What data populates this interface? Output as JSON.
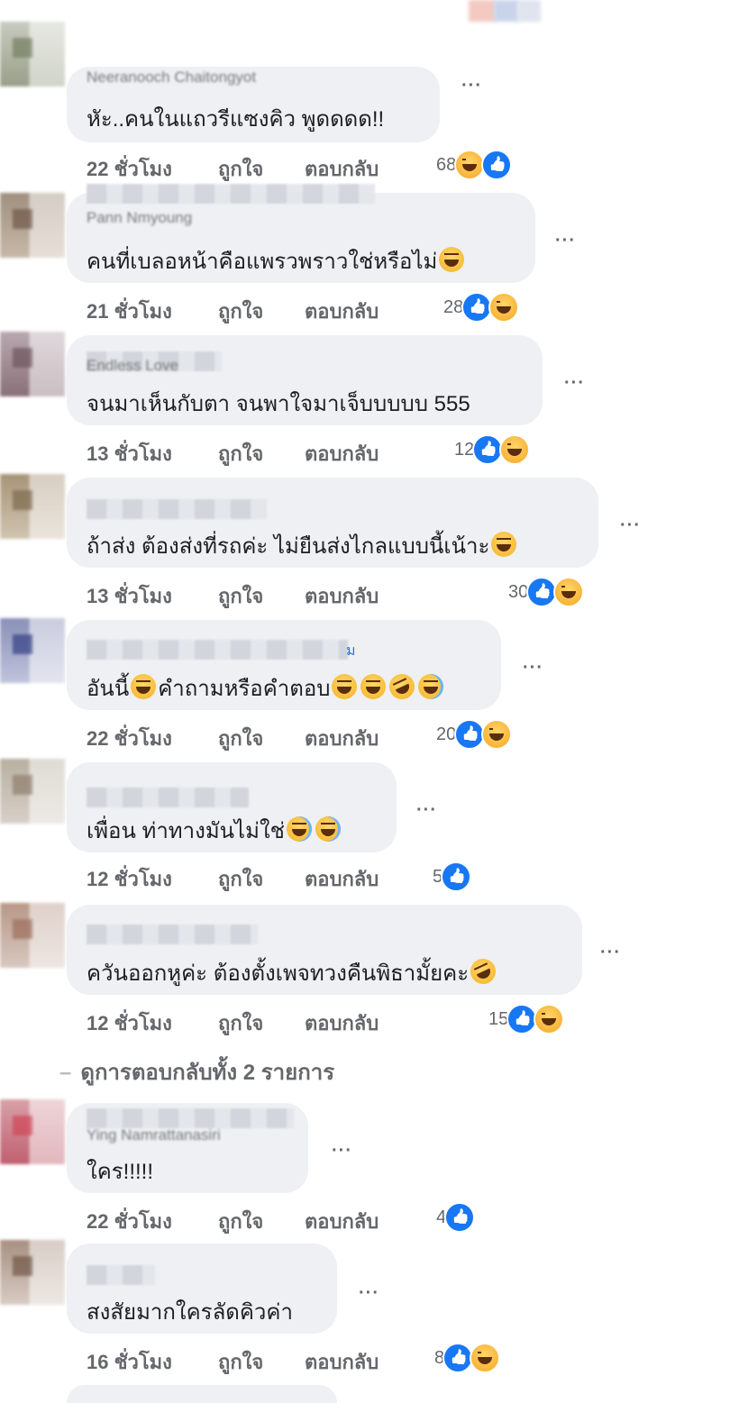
{
  "colors": {
    "bubble": "#eef0f3",
    "meta_text": "#65676b",
    "like_blue": "#1877f2",
    "haha_yellow": "#f7b928"
  },
  "icons": {
    "like": "like-reaction-icon",
    "haha": "haha-reaction-icon",
    "more": "more-options-icon",
    "laughing": "laughing-emoji-icon",
    "tears_of_joy": "tears-of-joy-emoji-icon",
    "rolling": "rolling-laughing-emoji-icon",
    "eye_roll": "eye-roll-emoji-icon"
  },
  "actions": {
    "like": "ถูกใจ",
    "reply": "ตอบกลับ"
  },
  "view_replies": "ดูการตอบกลับทั้ง 2 รายการ",
  "comments": [
    {
      "name": "Neeranooch Chaitongyot",
      "text": "หัะ..คนในแถวรีแซงคิว พูดดดด!!",
      "time": "22 ชั่วโมง",
      "count": "68"
    },
    {
      "name": "Pann Nmyoung",
      "text": "คนที่เบลอหน้าคือแพรวพราวใช่หรือไม่",
      "time": "21 ชั่วโมง",
      "count": "28"
    },
    {
      "name": "Endless Love",
      "text": "จนมาเห็นกับตา จนพาใจมาเจ็บบบบบ 555",
      "time": "13 ชั่วโมง",
      "count": "12"
    },
    {
      "name": "",
      "text": "ถ้าส่ง ต้องส่งที่รถค่ะ ไม่ยืนส่งไกลแบบนี้เน้าะ",
      "time": "13 ชั่วโมง",
      "count": "30"
    },
    {
      "name": "ม",
      "text_a": "อันนี้",
      "text_b": "คำถามหรือคำตอบ",
      "time": "22 ชั่วโมง",
      "count": "20"
    },
    {
      "name": "",
      "text": "เพื่อน ท่าทางมันไม่ใช่",
      "time": "12 ชั่วโมง",
      "count": "5"
    },
    {
      "name": "",
      "text": "ควันออกหูค่ะ ต้องตั้งเพจทวงคืนพิธามั้ยคะ",
      "time": "12 ชั่วโมง",
      "count": "15"
    },
    {
      "name": "Ying Namrattanasiri",
      "text": "ใคร!!!!!",
      "time": "22 ชั่วโมง",
      "count": "4"
    },
    {
      "name": "",
      "text": "สงสัยมากใครลัดคิวค่า",
      "time": "16 ชั่วโมง",
      "count": "8"
    }
  ]
}
